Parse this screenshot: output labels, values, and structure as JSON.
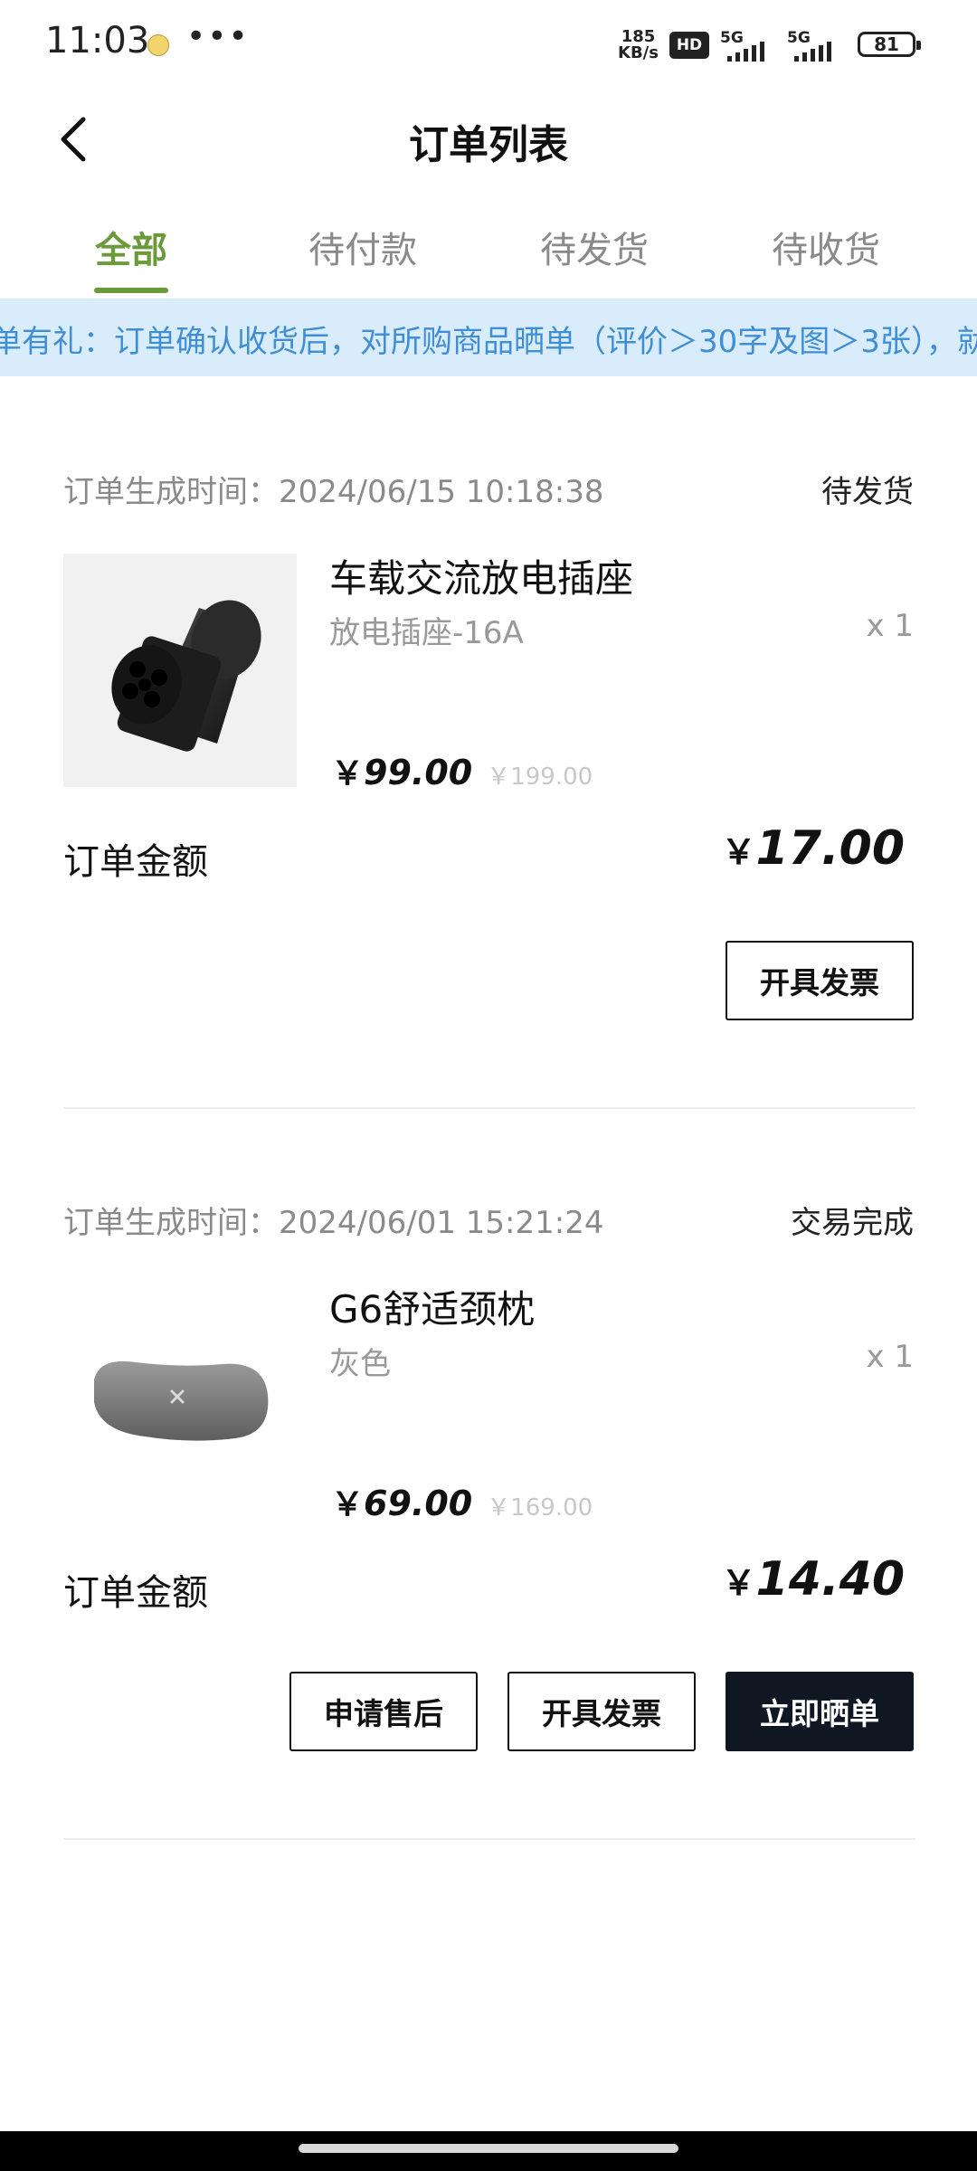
{
  "status_bar": {
    "time": "11:03",
    "more": "•••",
    "net_speed": "185",
    "net_unit": "KB/s",
    "hd": "HD",
    "sim1": "5G",
    "sim2": "5G",
    "battery": "81"
  },
  "header": {
    "title": "订单列表",
    "back_icon": "chevron-left-icon"
  },
  "tabs": [
    {
      "label": "全部",
      "active": true
    },
    {
      "label": "待付款",
      "active": false
    },
    {
      "label": "待发货",
      "active": false
    },
    {
      "label": "待收货",
      "active": false
    }
  ],
  "notice": {
    "text": "单有礼：订单确认收货后，对所购商品晒单（评价＞30字及图＞3张），就"
  },
  "orders": [
    {
      "time": "订单生成时间：2024/06/15 10:18:38",
      "status": "待发货",
      "product": {
        "name": "车载交流放电插座",
        "spec": "放电插座-16A",
        "qty": "x 1",
        "price_currency": "￥",
        "price": "99.00",
        "original_price": "￥199.00"
      },
      "amount_label": "订单金额",
      "amount_currency": "￥",
      "amount": "17.00",
      "buttons": [
        "开具发票"
      ]
    },
    {
      "time": "订单生成时间：2024/06/01 15:21:24",
      "status": "交易完成",
      "product": {
        "name": "G6舒适颈枕",
        "spec": "灰色",
        "qty": "x 1",
        "price_currency": "￥",
        "price": "69.00",
        "original_price": "￥169.00"
      },
      "amount_label": "订单金额",
      "amount_currency": "￥",
      "amount": "14.40",
      "buttons": [
        "申请售后",
        "开具发票",
        "立即晒单"
      ]
    }
  ],
  "colors": {
    "accent_green": "#6b9a3a",
    "notice_bg": "#d9ecfb",
    "notice_text": "#3f8ed6",
    "dark_button": "#0f1722"
  }
}
